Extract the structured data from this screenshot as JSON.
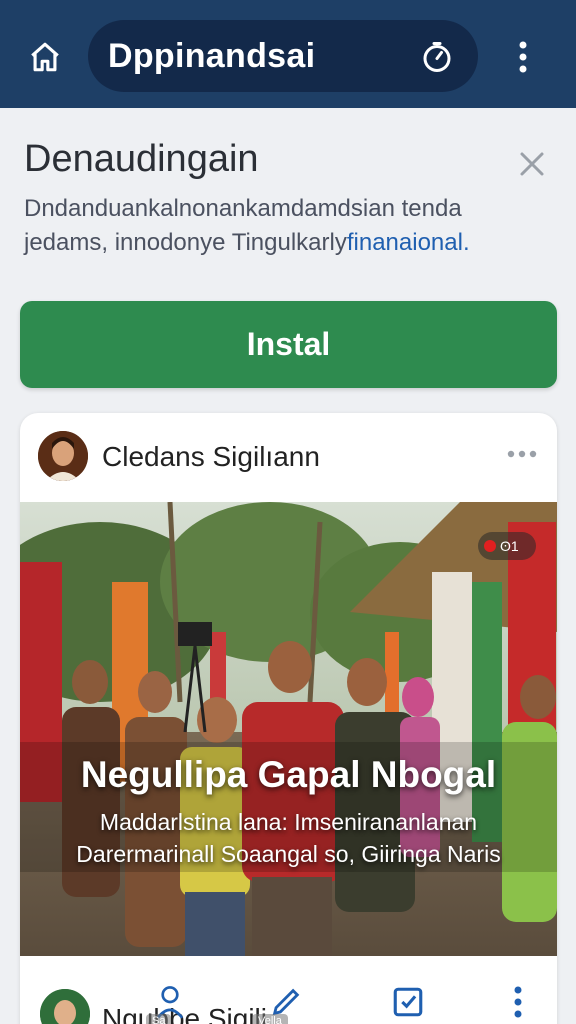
{
  "topbar": {
    "title": "Dppinandsai",
    "home_icon": "home-icon",
    "timer_icon": "timer-icon",
    "more_icon": "more-vertical-icon",
    "background": "#1e3f66"
  },
  "banner": {
    "title": "Denaudingain",
    "desc_line1": "Dndanduankalnonankamdamdsian tenda",
    "desc_line2_plain": "jedams, innodonye Tingulkarly",
    "desc_line2_link": "finanaional.",
    "close_icon": "close-icon",
    "install_label": "Instal",
    "install_color": "#2e8b4f"
  },
  "post": {
    "author": "Cledans Sigilıann",
    "more_icon": "more-horizontal-icon",
    "badge_text": "ʘ1",
    "overlay_title": "Negullipa Gapal Nbogal",
    "overlay_line1": "Maddarlstina lana: Imsenirananlanan",
    "overlay_line2": "Darermarinall Soaangal so, Giiringa Naris"
  },
  "post2": {
    "author": "Ngubbe Sigili"
  },
  "bottom_nav": {
    "items": [
      {
        "icon": "person-icon",
        "tip": "Sa"
      },
      {
        "icon": "pen-icon",
        "tip": "Vella"
      },
      {
        "icon": "checkbox-icon",
        "tip": ""
      },
      {
        "icon": "more-vertical-icon",
        "tip": ""
      }
    ]
  }
}
